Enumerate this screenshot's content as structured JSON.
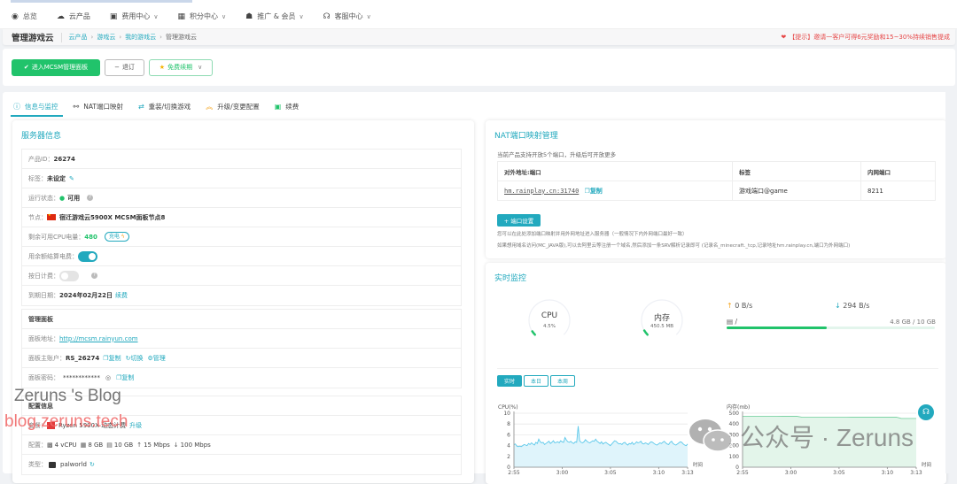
{
  "nav": {
    "items": [
      {
        "icon": "dashboard-icon",
        "glyph": "◉",
        "label": "总览",
        "dropdown": false
      },
      {
        "icon": "cloud-products-icon",
        "glyph": "☁",
        "label": "云产品",
        "dropdown": false
      },
      {
        "icon": "billing-icon",
        "glyph": "▣",
        "label": "费用中心",
        "dropdown": true
      },
      {
        "icon": "gift-icon",
        "glyph": "🎁",
        "label": "积分中心",
        "dropdown": true
      },
      {
        "icon": "users-icon",
        "glyph": "👥",
        "label": "推广 & 会员",
        "dropdown": true
      },
      {
        "icon": "headset-icon",
        "glyph": "🎧",
        "label": "客服中心",
        "dropdown": true
      }
    ],
    "chevron": "∨"
  },
  "breadcrumb": {
    "title": "管理游戏云",
    "items": [
      "云产品",
      "游戏云",
      "我的游戏云",
      "管理游戏云"
    ],
    "separator": "›"
  },
  "tip": "【提示】邀请一客户可得6元奖励和15~30%持续销售提成",
  "actions": {
    "enter_panel": "进入MCSM管理面板",
    "unsubscribe": "退订",
    "free_renew": "免费续期"
  },
  "tabs": [
    {
      "label": "信息与监控",
      "glyph": "ℹ",
      "active": true,
      "color": "#22a9be"
    },
    {
      "label": "NAT端口映射",
      "glyph": "⚯",
      "active": false,
      "color": "#444"
    },
    {
      "label": "重装/切换游戏",
      "glyph": "⇄",
      "active": false,
      "color": "#22a9be"
    },
    {
      "label": "升级/变更配置",
      "glyph": "⌃",
      "active": false,
      "color": "#f5a623"
    },
    {
      "label": "续费",
      "glyph": "▣",
      "active": false,
      "color": "#21c36b"
    }
  ],
  "server_info": {
    "title": "服务器信息",
    "product_id_label": "产品ID：",
    "product_id": "26274",
    "tag_label": "标签：",
    "tag": "未设定",
    "status_label": "运行状态：",
    "status": "可用",
    "node_label": "节点：",
    "node": "宿迁游戏云5900X MCSM面板节点8",
    "cpu_power_label": "剩余可用CPU电量：",
    "cpu_power": "480",
    "charge": "充电",
    "balance_billing_label": "用余额结算电费：",
    "balance_billing_on": true,
    "daily_billing_label": "按日计费：",
    "daily_billing_on": false,
    "expire_label": "到期日期：",
    "expire": "2024年02月22日",
    "renew": "续费"
  },
  "panel": {
    "title": "管理面板",
    "address_label": "面板地址：",
    "address": "http://mcsm.rainyun.com",
    "account_label": "面板主账户：",
    "account": "RS_26274",
    "copy": "复制",
    "switch": "切换",
    "manage": "管理",
    "password_label": "面板密码：",
    "password": "************"
  },
  "config": {
    "title": "配置信息",
    "plan_label": "套餐：",
    "plan": "Ryzen 5900X 动态计费",
    "upgrade": "升级",
    "spec_label": "配置：",
    "cpu": "4 vCPU",
    "ram": "8 GB",
    "disk": "10 GB",
    "up": "15 Mbps",
    "down": "100 Mbps",
    "type_label": "类型：",
    "type": "palworld"
  },
  "nat": {
    "title": "NAT端口映射管理",
    "desc": "当前产品支持开放5个端口，升级后可开放更多",
    "headers": [
      "对外地址:端口",
      "标签",
      "内网端口"
    ],
    "rows": [
      {
        "address": "hm.rainplay.cn:31740",
        "copy": "复制",
        "tag": "游戏端口@game",
        "port": "8211"
      }
    ],
    "add_button": "+ 端口设置",
    "hint1": "您可以在此处添加端口映射并用外网地址进入服务器（一般情况下内外网端口最好一致）",
    "hint2": "如果想用域名访问(MC_JAVA版),可以去阿里云等注册一个域名,然后添加一条SRV解析记录即可 (记录名_minecraft._tcp,记录地址hm.rainplay.cn,端口为外网端口)"
  },
  "monitor": {
    "title": "实时监控",
    "cpu_label": "CPU",
    "cpu_value": "4.5%",
    "cpu_fraction": 0.045,
    "mem_label": "内存",
    "mem_value": "450.5 MB",
    "mem_fraction": 0.055,
    "upload": "0 B/s",
    "download": "294 B/s",
    "disk_mount": "/",
    "disk_usage": "4.8 GB / 10 GB",
    "disk_fraction": 0.48,
    "ranges": [
      "实时",
      "本日",
      "本周"
    ],
    "active_range": 0
  },
  "chart_data": [
    {
      "type": "area",
      "title": "CPU(%)",
      "xlabel": "时间",
      "ylabel": "CPU(%)",
      "ylim": [
        0,
        10
      ],
      "yticks": [
        0,
        2,
        4,
        6,
        8,
        10
      ],
      "xticks": [
        "2:55",
        "3:00",
        "3:05",
        "3:10",
        "3:13"
      ],
      "x_range": [
        "2:55",
        "3:13"
      ],
      "color": "#5bc8ea",
      "fill": "#dff4fb",
      "grid": true,
      "values": [
        4.2,
        4.3,
        3.9,
        3.8,
        3.9,
        3.8,
        4.0,
        4.2,
        4.1,
        4.0,
        4.4,
        4.2,
        4.5,
        4.3,
        4.1,
        4.6,
        4.4,
        5.2,
        4.7,
        4.5,
        4.6,
        4.2,
        4.4,
        4.6,
        4.8,
        4.4,
        4.6,
        4.9,
        4.5,
        4.6,
        4.7,
        4.5,
        4.9,
        4.7,
        4.6,
        5.5,
        5.0,
        4.7,
        4.6,
        4.8,
        4.5,
        4.4,
        4.7,
        4.6,
        7.6,
        4.9,
        4.6,
        4.5,
        4.7,
        5.1,
        4.8,
        4.6,
        4.5,
        4.7,
        4.9,
        4.8,
        5.2,
        4.8,
        4.6,
        4.4,
        4.7,
        4.3,
        4.5,
        4.6,
        4.4,
        4.2,
        4.0,
        4.3,
        4.6,
        4.9,
        4.8,
        4.5,
        4.3,
        4.4,
        4.2,
        4.5,
        4.6,
        4.3,
        4.1,
        4.4,
        4.3,
        4.6,
        4.2,
        4.4,
        4.7,
        4.5,
        4.6,
        4.8,
        4.4,
        4.3,
        4.5,
        4.4,
        4.2,
        4.5,
        4.7,
        4.6,
        4.4,
        4.2,
        4.1,
        4.3,
        4.5,
        4.4,
        4.6,
        4.8,
        4.5,
        4.3,
        4.2,
        4.6,
        4.8,
        4.4,
        4.2,
        4.1,
        4.3,
        4.5,
        4.7,
        4.6,
        4.3,
        4.1,
        4.0,
        4.3
      ]
    },
    {
      "type": "area",
      "title": "内存(mb)",
      "xlabel": "时间",
      "ylabel": "内存(mb)",
      "ylim": [
        0,
        500
      ],
      "yticks": [
        0,
        100,
        200,
        300,
        400,
        500
      ],
      "xticks": [
        "2:55",
        "3:00",
        "3:05",
        "3:10",
        "3:13"
      ],
      "x_range": [
        "2:55",
        "3:13"
      ],
      "color": "#7fd3a5",
      "fill": "#e3f5ea",
      "grid": true,
      "values": [
        472,
        472,
        472,
        472,
        472,
        472,
        472,
        472,
        471,
        471,
        471,
        471,
        462,
        462,
        462,
        462,
        462,
        462,
        462,
        462,
        462,
        462,
        463,
        463,
        463,
        463,
        463,
        463,
        463,
        463,
        463,
        463,
        452,
        452,
        452,
        452
      ]
    }
  ],
  "watermarks": {
    "blog_name": "Zeruns 's Blog",
    "blog_url": "blog.zeruns.tech",
    "wechat": "公众号 · Zeruns"
  }
}
